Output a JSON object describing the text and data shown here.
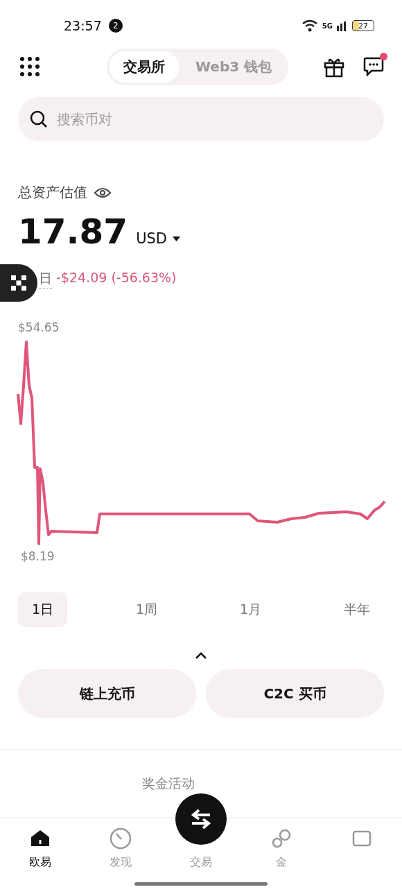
{
  "status_bar": {
    "time": "23:57",
    "notification_count": "2",
    "network": "5G",
    "battery": "27"
  },
  "header": {
    "tabs": [
      {
        "label": "交易所",
        "selected": true
      },
      {
        "label": "Web3 钱包",
        "selected": false
      }
    ],
    "message_unread": true
  },
  "search": {
    "placeholder": "搜索币对"
  },
  "assets": {
    "label": "总资产估值",
    "amount": "17.87",
    "currency": "USD",
    "period": "日",
    "change": "-$24.09 (-56.63%)"
  },
  "chart": {
    "max_label": "$54.65",
    "min_label": "$8.19"
  },
  "periods": [
    {
      "label": "1日",
      "selected": true
    },
    {
      "label": "1周",
      "selected": false
    },
    {
      "label": "1月",
      "selected": false
    },
    {
      "label": "半年",
      "selected": false
    }
  ],
  "actions": [
    {
      "label": "链上充币"
    },
    {
      "label": "C2C 买币"
    }
  ],
  "bonus": {
    "title": "奖金活动"
  },
  "bottom_nav": [
    {
      "label": "欧易",
      "kind": "home",
      "selected": true
    },
    {
      "label": "发现",
      "kind": "discover",
      "selected": false
    },
    {
      "label": "交易",
      "kind": "trade",
      "selected": false
    },
    {
      "label": "金",
      "kind": "finance",
      "selected": false
    },
    {
      "kind": "assets",
      "selected": false
    }
  ]
}
